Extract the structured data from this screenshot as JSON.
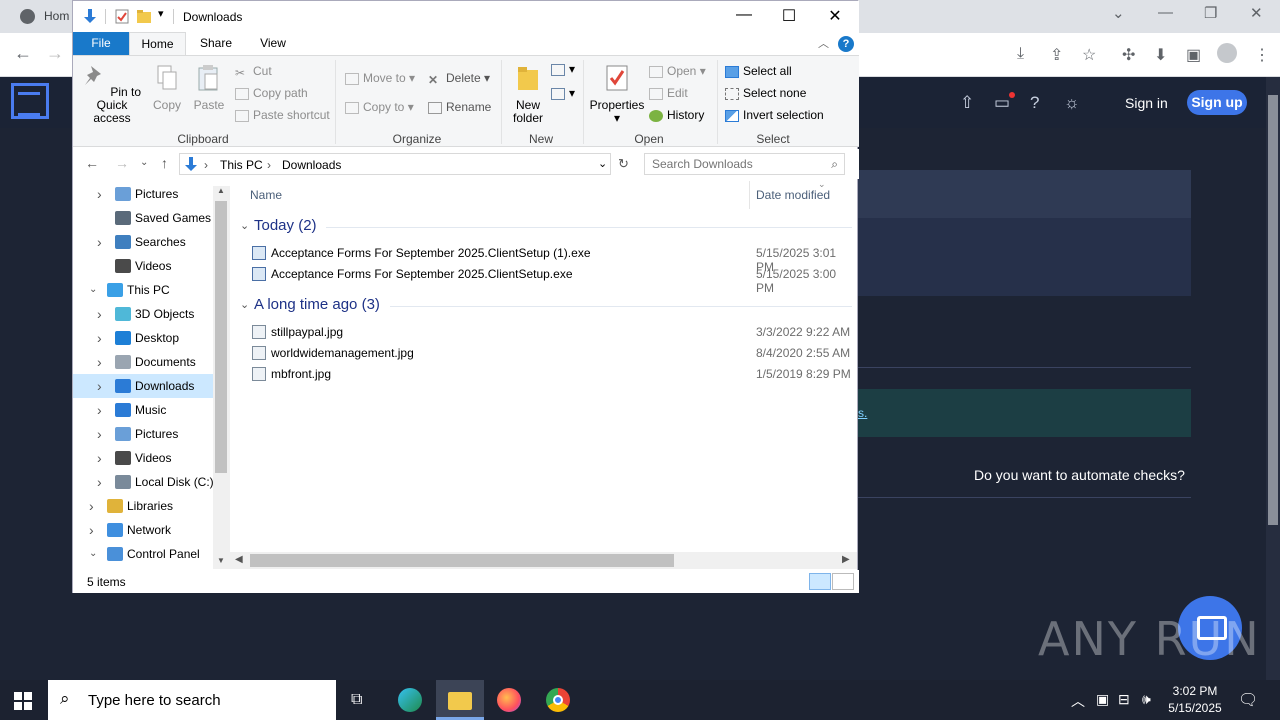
{
  "browser": {
    "tab_title": "Hom",
    "sign_in": "Sign in",
    "sign_up": "Sign up",
    "link_fragment": "s.",
    "automate_text": "Do you want to automate checks?",
    "watermark": "ANY RUN"
  },
  "explorer": {
    "title": "Downloads",
    "tabs": [
      "File",
      "Home",
      "Share",
      "View"
    ],
    "ribbon": {
      "clipboard": {
        "label": "Clipboard",
        "pin": "Pin to Quick access",
        "copy": "Copy",
        "paste": "Paste",
        "cut": "Cut",
        "copy_path": "Copy path",
        "paste_shortcut": "Paste shortcut"
      },
      "organize": {
        "label": "Organize",
        "move_to": "Move to",
        "copy_to": "Copy to",
        "delete": "Delete",
        "rename": "Rename"
      },
      "new": {
        "label": "New",
        "new_folder": "New folder"
      },
      "open": {
        "label": "Open",
        "properties": "Properties",
        "open": "Open",
        "edit": "Edit",
        "history": "History"
      },
      "select": {
        "label": "Select",
        "select_all": "Select all",
        "select_none": "Select none",
        "invert_selection": "Invert selection"
      }
    },
    "address": {
      "crumbs": [
        "This PC",
        "Downloads"
      ]
    },
    "search": {
      "placeholder": "Search Downloads"
    },
    "nav_pane": [
      {
        "label": "Pictures",
        "icon": "pictures-icon",
        "level": 1,
        "expander": "collapsed"
      },
      {
        "label": "Saved Games",
        "icon": "saved-games-icon",
        "level": 1,
        "expander": "none"
      },
      {
        "label": "Searches",
        "icon": "searches-icon",
        "level": 1,
        "expander": "collapsed"
      },
      {
        "label": "Videos",
        "icon": "videos-icon",
        "level": 1,
        "expander": "none"
      },
      {
        "label": "This PC",
        "icon": "this-pc-icon",
        "level": 0,
        "expander": "expanded"
      },
      {
        "label": "3D Objects",
        "icon": "3d-objects-icon",
        "level": 1,
        "expander": "collapsed"
      },
      {
        "label": "Desktop",
        "icon": "desktop-icon",
        "level": 1,
        "expander": "collapsed"
      },
      {
        "label": "Documents",
        "icon": "documents-icon",
        "level": 1,
        "expander": "collapsed"
      },
      {
        "label": "Downloads",
        "icon": "downloads-icon",
        "level": 1,
        "expander": "collapsed",
        "selected": true
      },
      {
        "label": "Music",
        "icon": "music-icon",
        "level": 1,
        "expander": "collapsed"
      },
      {
        "label": "Pictures",
        "icon": "pictures-icon",
        "level": 1,
        "expander": "collapsed"
      },
      {
        "label": "Videos",
        "icon": "videos-icon",
        "level": 1,
        "expander": "collapsed"
      },
      {
        "label": "Local Disk (C:)",
        "icon": "local-disk-icon",
        "level": 1,
        "expander": "collapsed"
      },
      {
        "label": "Libraries",
        "icon": "libraries-icon",
        "level": 0,
        "expander": "collapsed"
      },
      {
        "label": "Network",
        "icon": "network-icon",
        "level": 0,
        "expander": "collapsed"
      },
      {
        "label": "Control Panel",
        "icon": "control-panel-icon",
        "level": 0,
        "expander": "expanded"
      }
    ],
    "columns": {
      "name": "Name",
      "date_modified": "Date modified"
    },
    "groups": [
      {
        "heading": "Today (2)",
        "files": [
          {
            "name": "Acceptance Forms For September 2025.ClientSetup (1).exe",
            "date": "5/15/2025 3:01 PM",
            "icon": "exe-file-icon"
          },
          {
            "name": "Acceptance Forms For September 2025.ClientSetup.exe",
            "date": "5/15/2025 3:00 PM",
            "icon": "exe-file-icon"
          }
        ]
      },
      {
        "heading": "A long time ago (3)",
        "files": [
          {
            "name": "stillpaypal.jpg",
            "date": "3/3/2022 9:22 AM",
            "icon": "jpg-file-icon"
          },
          {
            "name": "worldwidemanagement.jpg",
            "date": "8/4/2020 2:55 AM",
            "icon": "jpg-file-icon"
          },
          {
            "name": "mbfront.jpg",
            "date": "1/5/2019 8:29 PM",
            "icon": "jpg-file-icon"
          }
        ]
      }
    ],
    "status": "5 items"
  },
  "taskbar": {
    "search_placeholder": "Type here to search",
    "time": "3:02 PM",
    "date": "5/15/2025"
  },
  "colors": {
    "accent": "#1979ca",
    "selection": "#cce8ff",
    "site_bg": "#1d2434",
    "sign_up_bg": "#3d75e8"
  }
}
